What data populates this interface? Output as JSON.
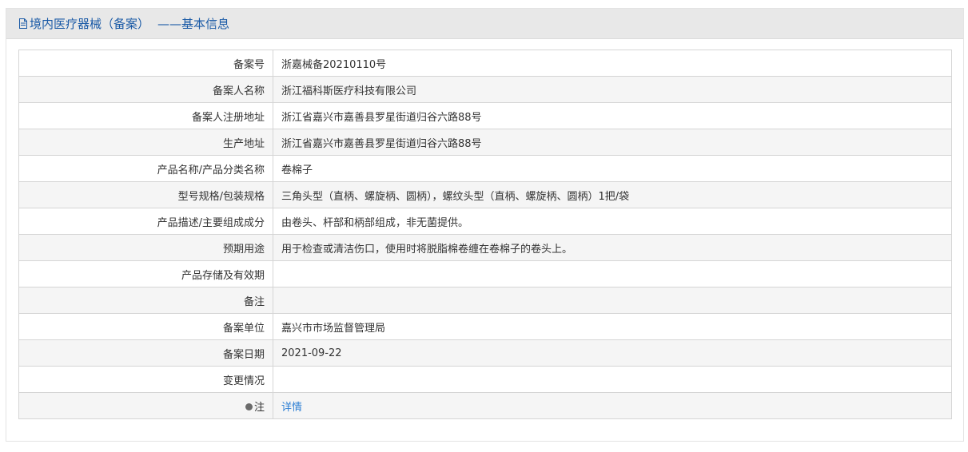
{
  "header": {
    "title": "境内医疗器械（备案）",
    "separator": "——",
    "subtitle": "基本信息",
    "icon": "document-icon"
  },
  "rows": [
    {
      "label": "备案号",
      "value": "浙嘉械备20210110号"
    },
    {
      "label": "备案人名称",
      "value": "浙江福科斯医疗科技有限公司"
    },
    {
      "label": "备案人注册地址",
      "value": "浙江省嘉兴市嘉善县罗星街道归谷六路88号"
    },
    {
      "label": "生产地址",
      "value": "浙江省嘉兴市嘉善县罗星街道归谷六路88号"
    },
    {
      "label": "产品名称/产品分类名称",
      "value": "卷棉子"
    },
    {
      "label": "型号规格/包装规格",
      "value": "三角头型（直柄、螺旋柄、圆柄），螺纹头型（直柄、螺旋柄、圆柄）1把/袋"
    },
    {
      "label": "产品描述/主要组成成分",
      "value": "由卷头、杆部和柄部组成，非无菌提供。"
    },
    {
      "label": "预期用途",
      "value": "用于检查或清洁伤口，使用时将脱脂棉卷缠在卷棉子的卷头上。"
    },
    {
      "label": "产品存储及有效期",
      "value": ""
    },
    {
      "label": "备注",
      "value": ""
    },
    {
      "label": "备案单位",
      "value": "嘉兴市市场监督管理局"
    },
    {
      "label": "备案日期",
      "value": "2021-09-22"
    },
    {
      "label": "变更情况",
      "value": ""
    }
  ],
  "note_row": {
    "label": "注",
    "icon": "bulb-icon",
    "link_text": "详情"
  },
  "colors": {
    "title": "#1a5aa6",
    "link": "#2d7fd4",
    "header_bg": "#e8e8e8",
    "row_alt_bg": "#f5f5f5",
    "border": "#d5d5d5"
  }
}
